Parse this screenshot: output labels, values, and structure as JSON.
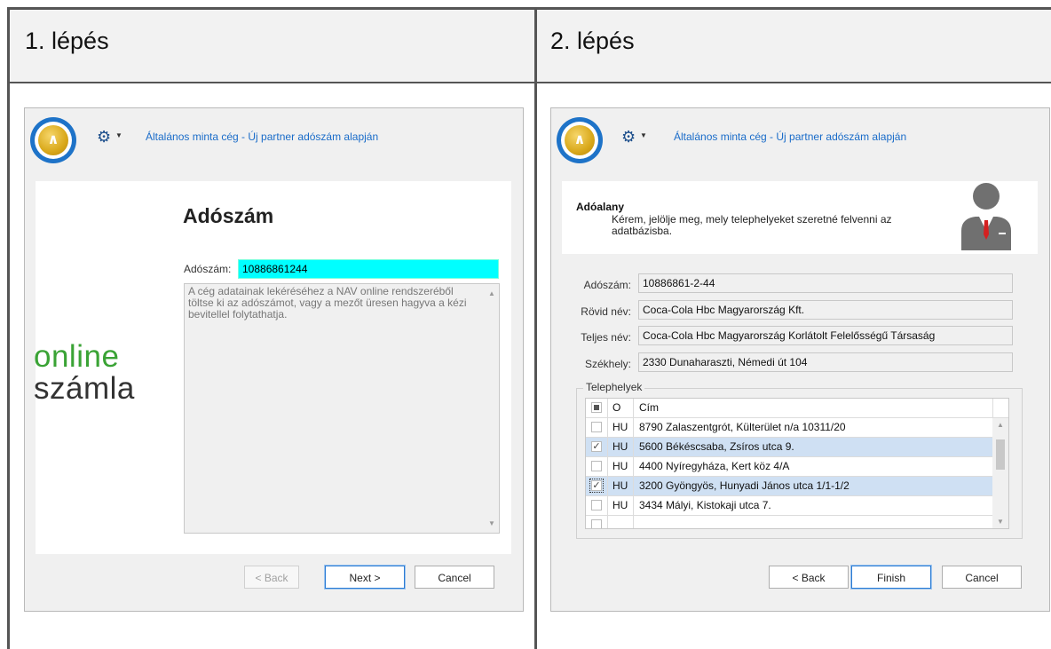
{
  "steps": [
    {
      "title": "1. lépés",
      "window": {
        "title": "Általános minta cég - Új partner adószám alapján",
        "brand_line1": "online",
        "brand_line2": "számla",
        "heading": "Adószám",
        "tax_label": "Adószám:",
        "tax_value": "10886861244",
        "info_text": "A cég adatainak lekéréséhez a NAV online rendszeréből töltse ki az adószámot, vagy a mezőt üresen hagyva a kézi bevitellel folytathatja.",
        "buttons": {
          "back": "< Back",
          "next": "Next >",
          "cancel": "Cancel"
        }
      }
    },
    {
      "title": "2. lépés",
      "window": {
        "title": "Általános minta cég - Új partner adószám alapján",
        "section_title": "Adóalany",
        "section_subtitle": "Kérem, jelölje meg, mely telephelyeket szeretné felvenni az adatbázisba.",
        "fields": [
          {
            "label": "Adószám:",
            "value": "10886861-2-44"
          },
          {
            "label": "Rövid név:",
            "value": "Coca-Cola Hbc Magyarország Kft."
          },
          {
            "label": "Teljes név:",
            "value": "Coca-Cola Hbc Magyarország Korlátolt Felelősségű Társaság"
          },
          {
            "label": "Székhely:",
            "value": "2330 Dunaharaszti, Némedi út 104"
          }
        ],
        "group_label": "Telephelyek",
        "grid_headers": {
          "country": "O",
          "address": "Cím"
        },
        "grid_rows": [
          {
            "checked": false,
            "country": "HU",
            "address": "8790 Zalaszentgrót, Külterület n/a 10311/20",
            "selected": false
          },
          {
            "checked": true,
            "country": "HU",
            "address": "5600 Békéscsaba, Zsíros utca 9.",
            "selected": true
          },
          {
            "checked": false,
            "country": "HU",
            "address": "4400 Nyíregyháza, Kert köz 4/A",
            "selected": false
          },
          {
            "checked": true,
            "country": "HU",
            "address": "3200 Gyöngyös, Hunyadi János utca 1/1-1/2",
            "selected": true
          },
          {
            "checked": false,
            "country": "HU",
            "address": "3434 Mályi, Kistokaji utca 7.",
            "selected": false
          }
        ],
        "buttons": {
          "back": "< Back",
          "finish": "Finish",
          "cancel": "Cancel"
        }
      }
    }
  ],
  "colors": {
    "accent_blue": "#1a6cc9",
    "brand_green": "#3aa335",
    "tax_input_bg": "#00ffff",
    "selected_row": "#cfe0f3"
  },
  "icons": [
    "app-logo-icon",
    "gear-icon",
    "person-icon",
    "scroll-up-icon",
    "scroll-down-icon",
    "checkbox-icon"
  ]
}
